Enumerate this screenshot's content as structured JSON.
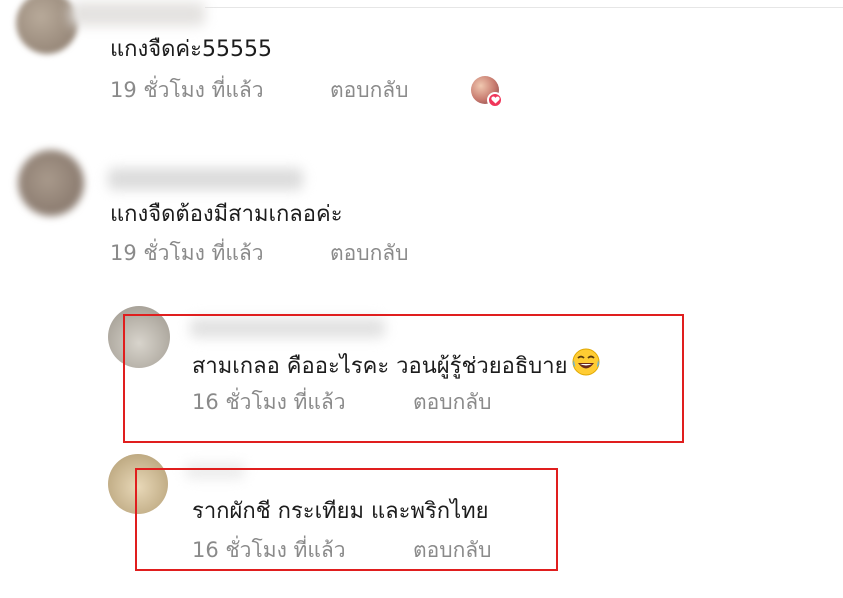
{
  "comments": [
    {
      "text": "แกงจืดค่ะ55555",
      "time": "19 ชั่วโมง ที่แล้ว",
      "reply": "ตอบกลับ",
      "reaction": "heart-icon"
    },
    {
      "text": "แกงจืดต้องมีสามเกลอค่ะ",
      "time": "19 ชั่วโมง ที่แล้ว",
      "reply": "ตอบกลับ"
    },
    {
      "text": "สามเกลอ คืออะไรคะ วอนผู้รู้ช่วยอธิบาย",
      "emoji": "laughing-tears-emoji",
      "time": "16 ชั่วโมง ที่แล้ว",
      "reply": "ตอบกลับ"
    },
    {
      "text": "รากผักชี กระเทียม และพริกไทย",
      "time": "16 ชั่วโมง ที่แล้ว",
      "reply": "ตอบกลับ"
    }
  ],
  "colors": {
    "highlight": "#e01e1e",
    "meta_text": "#8a8a8a",
    "heart": "#f0365a"
  }
}
